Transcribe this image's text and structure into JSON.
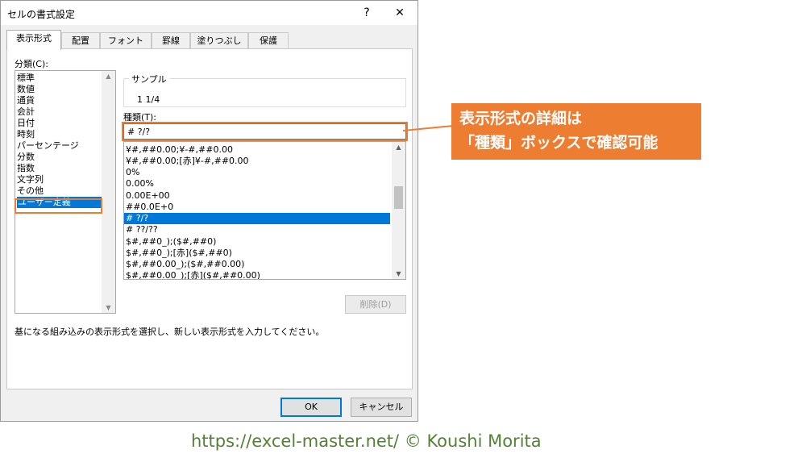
{
  "dialog": {
    "title": "セルの書式設定",
    "help_label": "?",
    "close_label": "✕"
  },
  "tabs": [
    "表示形式",
    "配置",
    "フォント",
    "罫線",
    "塗りつぶし",
    "保護"
  ],
  "category": {
    "label": "分類(C):",
    "items": [
      "標準",
      "数値",
      "通貨",
      "会計",
      "日付",
      "時刻",
      "パーセンテージ",
      "分数",
      "指数",
      "文字列",
      "その他",
      "ユーザー定義"
    ],
    "selected": "ユーザー定義"
  },
  "sample": {
    "label": "サンプル",
    "value": "1 1/4"
  },
  "type": {
    "label": "種類(T):",
    "input_value": "# ?/?",
    "items": [
      "¥#,##0.00;¥-#,##0.00",
      "¥#,##0.00;[赤]¥-#,##0.00",
      "0%",
      "0.00%",
      "0.00E+00",
      "##0.0E+0",
      "# ?/?",
      "# ??/??",
      "$#,##0_);($#,##0)",
      "$#,##0_);[赤]($#,##0)",
      "$#,##0.00_);($#,##0.00)",
      "$#,##0.00_);[赤]($#,##0.00)"
    ],
    "selected": "# ?/?"
  },
  "delete_button": "削除(D)",
  "description": "基になる組み込みの表示形式を選択し、新しい表示形式を入力してください。",
  "ok_button": "OK",
  "cancel_button": "キャンセル",
  "callout": {
    "line1": "表示形式の詳細は",
    "line2": "「種類」ボックスで確認可能"
  },
  "footer": "https://excel-master.net/  © Koushi Morita",
  "colors": {
    "accent": "#ed7d31",
    "selection": "#0078d7",
    "footer_text": "#548235"
  }
}
